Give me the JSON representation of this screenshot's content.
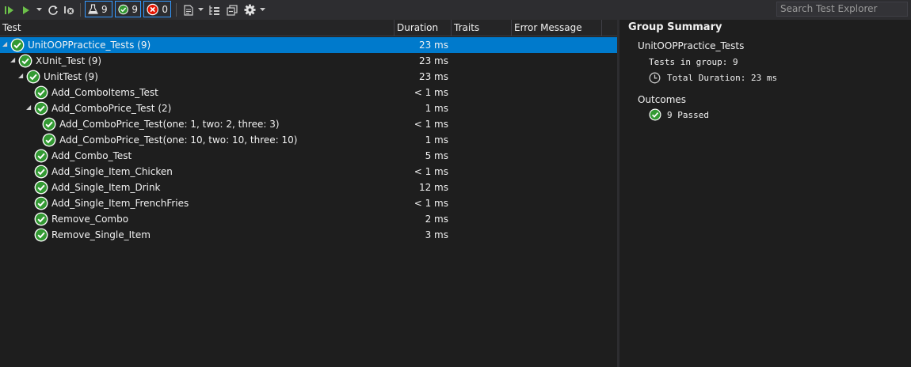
{
  "toolbar": {
    "run_all_icon": "run-all-icon",
    "run_icon": "run-icon",
    "refresh_icon": "refresh-icon",
    "cancel_icon": "cancel-icon",
    "total_count": "9",
    "passed_count": "9",
    "failed_count": "0",
    "search_placeholder": "Search Test Explorer"
  },
  "columns": {
    "test": "Test",
    "duration": "Duration",
    "traits": "Traits",
    "error": "Error Message"
  },
  "rows": [
    {
      "name": "UnitOOPPractice_Tests (9)",
      "duration": "23 ms"
    },
    {
      "name": "XUnit_Test (9)",
      "duration": "23 ms"
    },
    {
      "name": "UnitTest (9)",
      "duration": "23 ms"
    },
    {
      "name": "Add_ComboItems_Test",
      "duration": "< 1 ms"
    },
    {
      "name": "Add_ComboPrice_Test (2)",
      "duration": "1 ms"
    },
    {
      "name": "Add_ComboPrice_Test(one: 1, two: 2, three: 3)",
      "duration": "< 1 ms"
    },
    {
      "name": "Add_ComboPrice_Test(one: 10, two: 10, three: 10)",
      "duration": "1 ms"
    },
    {
      "name": "Add_Combo_Test",
      "duration": "5 ms"
    },
    {
      "name": "Add_Single_Item_Chicken",
      "duration": "< 1 ms"
    },
    {
      "name": "Add_Single_Item_Drink",
      "duration": "12 ms"
    },
    {
      "name": "Add_Single_Item_FrenchFries",
      "duration": "< 1 ms"
    },
    {
      "name": "Remove_Combo",
      "duration": "2 ms"
    },
    {
      "name": "Remove_Single_Item",
      "duration": "3 ms"
    }
  ],
  "summary": {
    "title": "Group Summary",
    "group_name": "UnitOOPPractice_Tests",
    "tests_in_group": "Tests in group: 9",
    "total_duration": "Total Duration: 23 ms",
    "outcomes_label": "Outcomes",
    "passed": "9 Passed"
  },
  "colors": {
    "accent": "#007acc",
    "pass": "#339933",
    "fail": "#e51400"
  }
}
